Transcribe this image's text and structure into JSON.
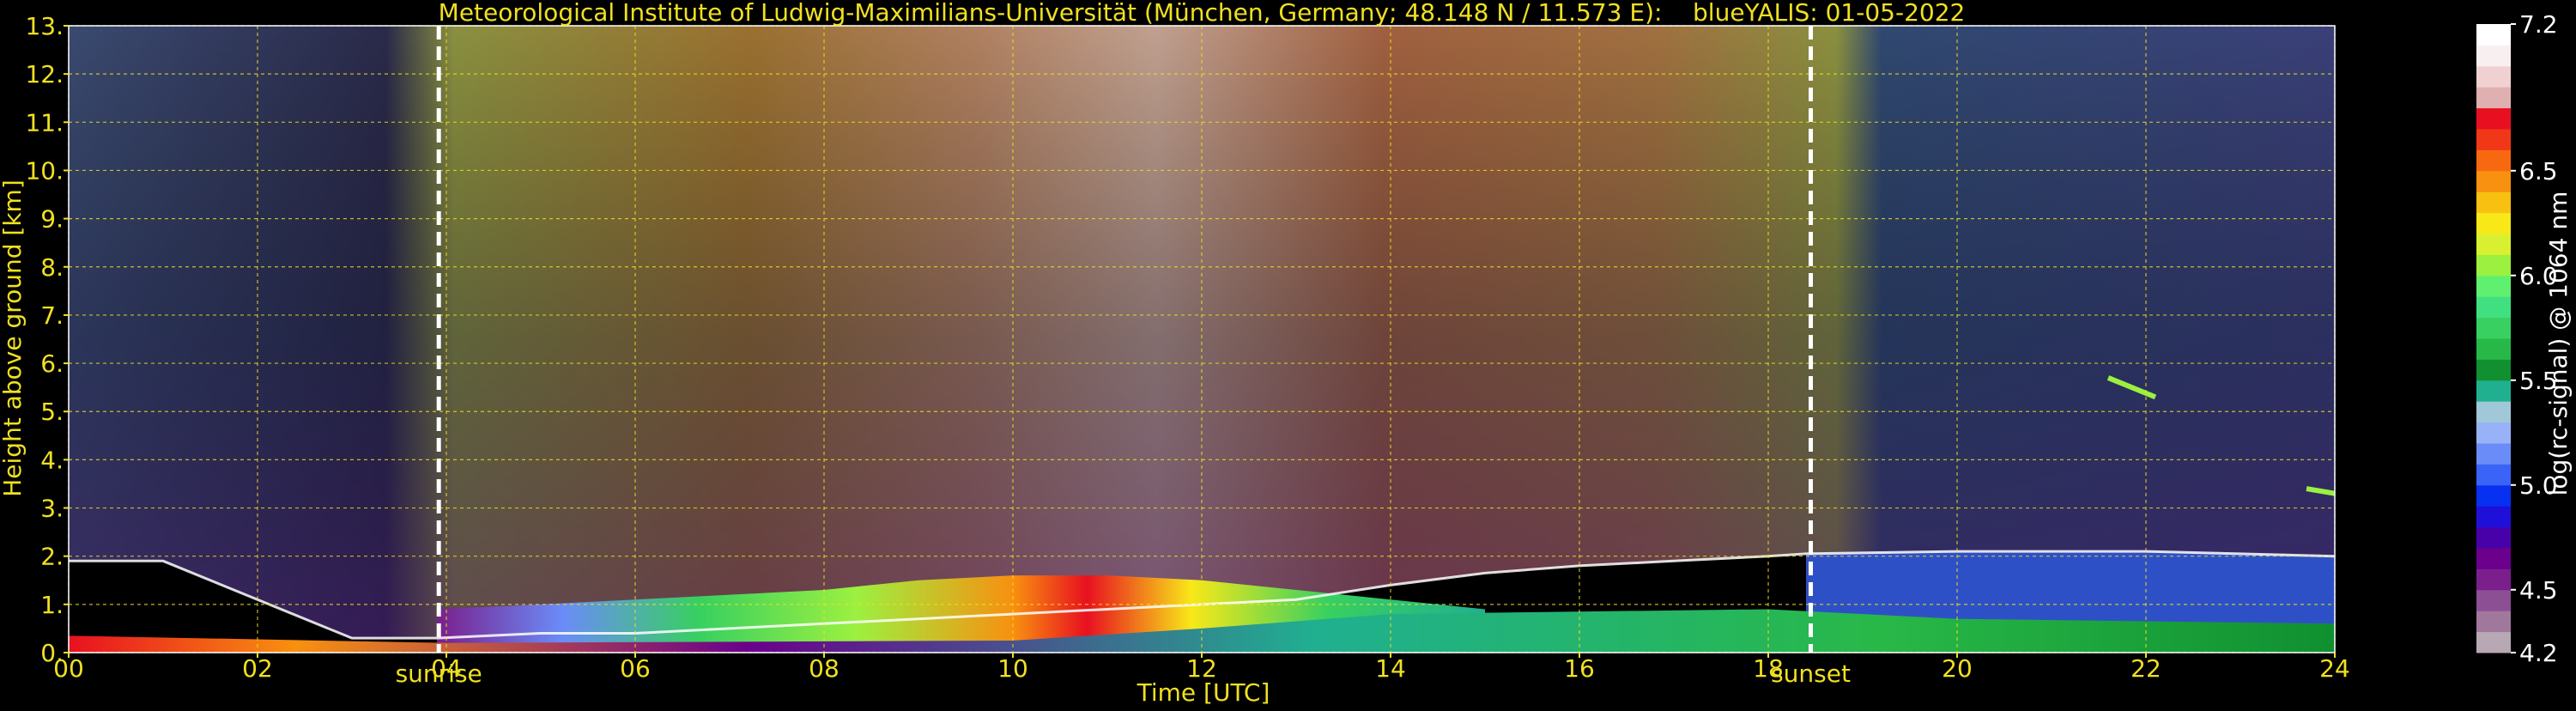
{
  "chart_data": {
    "type": "heatmap",
    "title": "Meteorological Institute of Ludwig-Maximilians-Universität (München, Germany; 48.148 N / 11.573 E):    blueYALIS: 01-05-2022",
    "xlabel": "Time [UTC]",
    "ylabel": "Height above ground [km]",
    "xlim": [
      0,
      24
    ],
    "ylim": [
      0,
      13
    ],
    "x_ticks": [
      {
        "value": 0,
        "label": "00"
      },
      {
        "value": 2,
        "label": "02"
      },
      {
        "value": 4,
        "label": "04"
      },
      {
        "value": 6,
        "label": "06"
      },
      {
        "value": 8,
        "label": "08"
      },
      {
        "value": 10,
        "label": "10"
      },
      {
        "value": 12,
        "label": "12"
      },
      {
        "value": 14,
        "label": "14"
      },
      {
        "value": 16,
        "label": "16"
      },
      {
        "value": 18,
        "label": "18"
      },
      {
        "value": 20,
        "label": "20"
      },
      {
        "value": 22,
        "label": "22"
      },
      {
        "value": 24,
        "label": "24"
      }
    ],
    "y_ticks": [
      {
        "value": 0,
        "label": "0."
      },
      {
        "value": 1,
        "label": "1."
      },
      {
        "value": 2,
        "label": "2."
      },
      {
        "value": 3,
        "label": "3."
      },
      {
        "value": 4,
        "label": "4."
      },
      {
        "value": 5,
        "label": "5."
      },
      {
        "value": 6,
        "label": "6."
      },
      {
        "value": 7,
        "label": "7."
      },
      {
        "value": 8,
        "label": "8."
      },
      {
        "value": 9,
        "label": "9."
      },
      {
        "value": 10,
        "label": "10."
      },
      {
        "value": 11,
        "label": "11."
      },
      {
        "value": 12,
        "label": "12."
      },
      {
        "value": 13,
        "label": "13."
      }
    ],
    "grid": true,
    "annotations": [
      {
        "label": "sunrise",
        "x": 3.92
      },
      {
        "label": "sunset",
        "x": 18.45
      }
    ],
    "colorbar": {
      "label": "log(rc-signal) @ 1064 nm",
      "range": [
        4.2,
        7.2
      ],
      "ticks": [
        {
          "value": 7.2,
          "label": "7.2"
        },
        {
          "value": 6.5,
          "label": "6.5"
        },
        {
          "value": 6.0,
          "label": "6.0"
        },
        {
          "value": 5.5,
          "label": "5.5"
        },
        {
          "value": 5.0,
          "label": "5.0"
        },
        {
          "value": 4.5,
          "label": "4.5"
        },
        {
          "value": 4.2,
          "label": "4.2"
        }
      ],
      "colors": [
        "#b8a8b4",
        "#a0789c",
        "#8c4f94",
        "#7a1f8c",
        "#6a008c",
        "#4800a8",
        "#1e10d8",
        "#0830f0",
        "#3a64f8",
        "#6a8cf8",
        "#98b2f8",
        "#a0c8d8",
        "#20b090",
        "#109030",
        "#28b848",
        "#38d060",
        "#40e080",
        "#60f070",
        "#9cf040",
        "#d8f030",
        "#f8e818",
        "#f8c010",
        "#f89010",
        "#f86810",
        "#f03818",
        "#e81020",
        "#e0b0b0",
        "#f0d0d0",
        "#f8f0f0",
        "#ffffff"
      ]
    },
    "layers": {
      "boundary_layer_top_km": [
        [
          0.0,
          1.9
        ],
        [
          1.0,
          1.9
        ],
        [
          3.0,
          0.3
        ],
        [
          3.9,
          0.3
        ],
        [
          5.0,
          0.4
        ],
        [
          6.0,
          0.4
        ],
        [
          7.0,
          0.5
        ],
        [
          8.0,
          0.6
        ],
        [
          9.0,
          0.7
        ],
        [
          10.0,
          0.8
        ],
        [
          11.0,
          0.9
        ],
        [
          12.0,
          1.0
        ],
        [
          13.0,
          1.1
        ],
        [
          14.0,
          1.4
        ],
        [
          15.0,
          1.65
        ],
        [
          16.0,
          1.8
        ],
        [
          17.0,
          1.9
        ],
        [
          18.0,
          2.0
        ],
        [
          18.4,
          2.05
        ],
        [
          20.0,
          2.1
        ],
        [
          22.0,
          2.1
        ],
        [
          24.0,
          2.0
        ]
      ],
      "elevated_aerosol_top_km": [
        [
          3.9,
          0.9
        ],
        [
          5.0,
          1.0
        ],
        [
          6.0,
          1.1
        ],
        [
          7.0,
          1.2
        ],
        [
          8.0,
          1.3
        ],
        [
          9.0,
          1.5
        ],
        [
          10.0,
          1.6
        ],
        [
          11.0,
          1.6
        ],
        [
          12.0,
          1.5
        ],
        [
          13.0,
          1.3
        ],
        [
          14.0,
          1.1
        ],
        [
          15.0,
          0.9
        ]
      ],
      "cloud_streak": [
        [
          21.6,
          5.7
        ],
        [
          22.1,
          5.3
        ]
      ],
      "cloud_patch": [
        [
          23.7,
          3.4
        ],
        [
          24.0,
          3.3
        ]
      ]
    }
  }
}
